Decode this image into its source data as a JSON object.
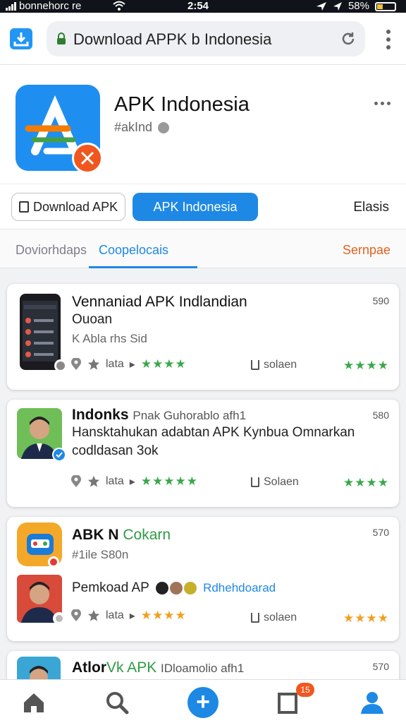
{
  "status_bar": {
    "carrier": "bonnehorc re",
    "time": "2:54",
    "battery": "58%"
  },
  "browser": {
    "url": "Download APPK b Indonesia"
  },
  "app": {
    "title": "APK Indonesia",
    "subtitle": "#akInd"
  },
  "chips": {
    "download": "Download APK",
    "active": "APK Indonesia",
    "right": "Elasis"
  },
  "tabs": {
    "tab1": "Doviorhdaps",
    "tab2": "Coopelocais",
    "tab3": "Sernpae"
  },
  "cards": [
    {
      "title": "Vennaniad APK Indlandian",
      "line2": "Ouoan",
      "line3": "K Abla rhs Sid",
      "number": "590",
      "meta_label": "lata",
      "share_label": "solaen",
      "stars_left": "★★★★",
      "stars_right": "★★★★"
    },
    {
      "title": "Indonks",
      "title_suffix": "Pnak Guhorablo afh1",
      "line2": "Hansktahukan adabtan APK Kynbua Omnarkan",
      "line3": "codldasan 3ok",
      "number": "580",
      "meta_label": "lata",
      "share_label": "Solaen",
      "stars_left": "★★★★★",
      "stars_right": "★★★★"
    },
    {
      "title": "ABK N",
      "title_suffix": "Cokarn",
      "line2": "#1ile S80n",
      "line3": "Pemkoad AP",
      "line3_link": "Rdhehdoarad",
      "number": "570",
      "meta_label": "lata",
      "share_label": "solaen",
      "stars_left": "★★★★",
      "stars_right": "★★★★"
    },
    {
      "title": "Atlor",
      "title_suffix": "Vk APK",
      "title_rest": "IDloamolio afh1",
      "number": "570"
    }
  ],
  "colors": {
    "accent": "#1e88e5",
    "orange": "#f0571f",
    "green_stars": "#3aa84a",
    "orange_stars": "#f0a020"
  },
  "notification_count": "15"
}
